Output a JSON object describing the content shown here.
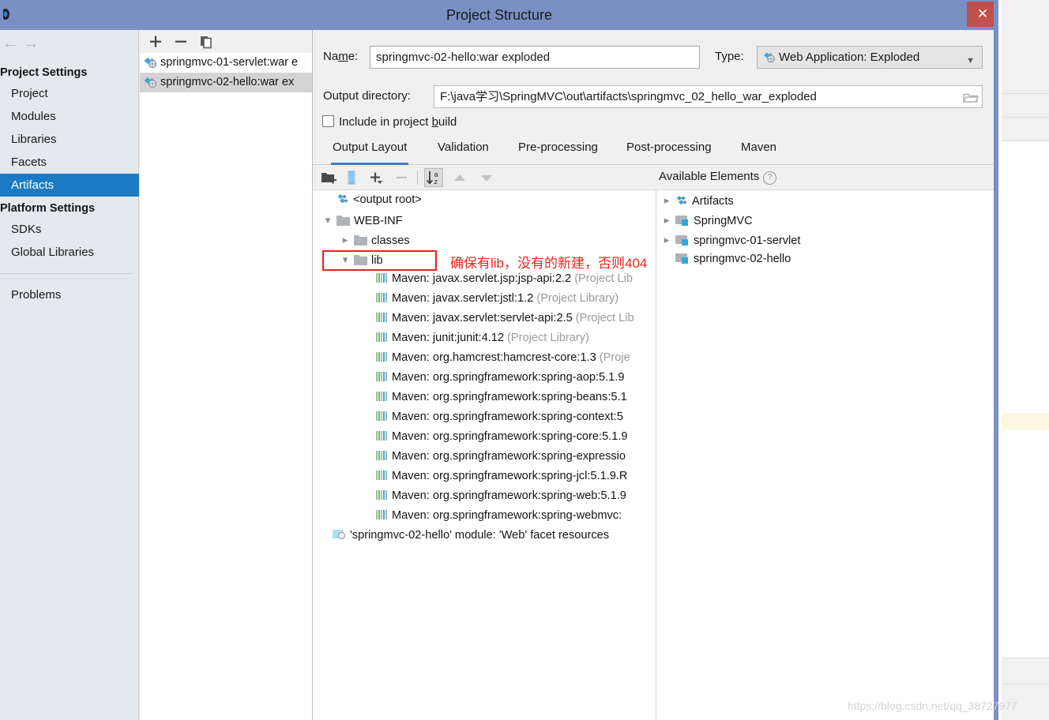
{
  "window": {
    "title": "Project Structure",
    "close_label": "✕"
  },
  "sidebar": {
    "nav": {
      "back": "←",
      "forward": "→"
    },
    "groups": [
      {
        "label": "Project Settings",
        "items": [
          {
            "label": "Project",
            "selected": false
          },
          {
            "label": "Modules",
            "selected": false
          },
          {
            "label": "Libraries",
            "selected": false
          },
          {
            "label": "Facets",
            "selected": false
          },
          {
            "label": "Artifacts",
            "selected": true
          }
        ]
      },
      {
        "label": "Platform Settings",
        "items": [
          {
            "label": "SDKs",
            "selected": false
          },
          {
            "label": "Global Libraries",
            "selected": false
          }
        ]
      }
    ],
    "problems": {
      "label": "Problems"
    }
  },
  "artifact_panel": {
    "toolbar": [
      {
        "name": "add-artifact-button",
        "glyph": "+"
      },
      {
        "name": "remove-artifact-button",
        "glyph": "−"
      },
      {
        "name": "copy-artifact-button",
        "glyph": "copy-icon"
      }
    ],
    "items": [
      {
        "label": "springmvc-01-servlet:war e",
        "selected": false
      },
      {
        "label": "springmvc-02-hello:war ex",
        "selected": true
      }
    ]
  },
  "form": {
    "name_label": "Name:",
    "name_value": "springmvc-02-hello:war exploded",
    "type_label": "Type:",
    "type_value": "Web Application: Exploded",
    "output_dir_label": "Output directory:",
    "output_dir_value": "F:\\java学习\\SpringMVC\\out\\artifacts\\springmvc_02_hello_war_exploded",
    "include_in_build_label_pre": "Include in project ",
    "include_in_build_label_underline": "b",
    "include_in_build_label_post": "uild",
    "include_in_build_checked": false
  },
  "tabs": [
    {
      "label": "Output Layout",
      "active": true
    },
    {
      "label": "Validation",
      "active": false
    },
    {
      "label": "Pre-processing",
      "active": false
    },
    {
      "label": "Post-processing",
      "active": false
    },
    {
      "label": "Maven",
      "active": false
    }
  ],
  "layout_toolbar": [
    {
      "name": "create-directory-button",
      "icon": "new-folder-icon",
      "enabled": true,
      "active": false
    },
    {
      "name": "create-archive-button",
      "icon": "archive-icon",
      "enabled": true,
      "active": false
    },
    {
      "name": "add-copy-of-button",
      "icon": "plus-dropdown-icon",
      "enabled": true,
      "active": false
    },
    {
      "name": "remove-element-button",
      "icon": "minus-icon",
      "enabled": false,
      "active": false
    },
    {
      "name": "sort-alphabetically-button",
      "icon": "sort-az-icon",
      "enabled": true,
      "active": true
    },
    {
      "name": "move-up-button",
      "icon": "arrow-up-icon",
      "enabled": false,
      "active": false
    },
    {
      "name": "move-down-button",
      "icon": "arrow-down-icon",
      "enabled": false,
      "active": false
    }
  ],
  "available_elements": {
    "header": "Available Elements",
    "help_glyph": "?",
    "items": [
      {
        "label": "Artifacts",
        "icon": "artifact-diamond-icon",
        "expandable": true,
        "indent": 0
      },
      {
        "label": "SpringMVC",
        "icon": "module-folder-icon",
        "expandable": true,
        "indent": 0
      },
      {
        "label": "springmvc-01-servlet",
        "icon": "module-folder-icon",
        "expandable": true,
        "indent": 0
      },
      {
        "label": "springmvc-02-hello",
        "icon": "module-folder-icon",
        "expandable": false,
        "indent": 0
      }
    ]
  },
  "output_tree": [
    {
      "label": "<output root>",
      "suffix": "",
      "icon": "artifact-diamond-icon",
      "indent": 0,
      "twisty": "",
      "highlight": false
    },
    {
      "label": "WEB-INF",
      "suffix": "",
      "icon": "folder-icon",
      "indent": 1,
      "twisty": "down",
      "highlight": false
    },
    {
      "label": "classes",
      "suffix": "",
      "icon": "folder-icon",
      "indent": 2,
      "twisty": "right",
      "highlight": false
    },
    {
      "label": "lib",
      "suffix": "",
      "icon": "folder-icon",
      "indent": 2,
      "twisty": "down",
      "highlight": true
    },
    {
      "label": "Maven: javax.servlet.jsp:jsp-api:2.2",
      "suffix": "(Project Lib",
      "icon": "maven-jar-icon",
      "indent": 4,
      "twisty": "",
      "highlight": false
    },
    {
      "label": "Maven: javax.servlet:jstl:1.2",
      "suffix": "(Project Library)",
      "icon": "maven-jar-icon",
      "indent": 4,
      "twisty": "",
      "highlight": false
    },
    {
      "label": "Maven: javax.servlet:servlet-api:2.5",
      "suffix": "(Project Lib",
      "icon": "maven-jar-icon",
      "indent": 4,
      "twisty": "",
      "highlight": false
    },
    {
      "label": "Maven: junit:junit:4.12",
      "suffix": "(Project Library)",
      "icon": "maven-jar-icon",
      "indent": 4,
      "twisty": "",
      "highlight": false
    },
    {
      "label": "Maven: org.hamcrest:hamcrest-core:1.3",
      "suffix": "(Proje",
      "icon": "maven-jar-icon",
      "indent": 4,
      "twisty": "",
      "highlight": false
    },
    {
      "label": "Maven: org.springframework:spring-aop:5.1.9",
      "suffix": "",
      "icon": "maven-jar-icon",
      "indent": 4,
      "twisty": "",
      "highlight": false
    },
    {
      "label": "Maven: org.springframework:spring-beans:5.1",
      "suffix": "",
      "icon": "maven-jar-icon",
      "indent": 4,
      "twisty": "",
      "highlight": false
    },
    {
      "label": "Maven: org.springframework:spring-context:5",
      "suffix": "",
      "icon": "maven-jar-icon",
      "indent": 4,
      "twisty": "",
      "highlight": false
    },
    {
      "label": "Maven: org.springframework:spring-core:5.1.9",
      "suffix": "",
      "icon": "maven-jar-icon",
      "indent": 4,
      "twisty": "",
      "highlight": false
    },
    {
      "label": "Maven: org.springframework:spring-expressio",
      "suffix": "",
      "icon": "maven-jar-icon",
      "indent": 4,
      "twisty": "",
      "highlight": false
    },
    {
      "label": "Maven: org.springframework:spring-jcl:5.1.9.R",
      "suffix": "",
      "icon": "maven-jar-icon",
      "indent": 4,
      "twisty": "",
      "highlight": false
    },
    {
      "label": "Maven: org.springframework:spring-web:5.1.9",
      "suffix": "",
      "icon": "maven-jar-icon",
      "indent": 4,
      "twisty": "",
      "highlight": false
    },
    {
      "label": "Maven: org.springframework:spring-webmvc:",
      "suffix": "",
      "icon": "maven-jar-icon",
      "indent": 4,
      "twisty": "",
      "highlight": false
    },
    {
      "label": "'springmvc-02-hello' module: 'Web' facet resources",
      "suffix": "",
      "icon": "module-web-icon",
      "indent": 1,
      "twisty": "",
      "highlight": false
    }
  ],
  "annotation": {
    "text": "确保有lib，没有的新建，否则404",
    "color": "#f0261c"
  },
  "watermark": {
    "text": "https://blog.csdn.net/qq_38727977"
  },
  "colors": {
    "titlebar": "#7a8fc4",
    "close": "#c0504d",
    "selection": "#1a7bc4",
    "tab_active_underline": "#3d7ec0",
    "sidebar_bg": "#e4e9ee",
    "annotation_red": "#f0261c"
  }
}
